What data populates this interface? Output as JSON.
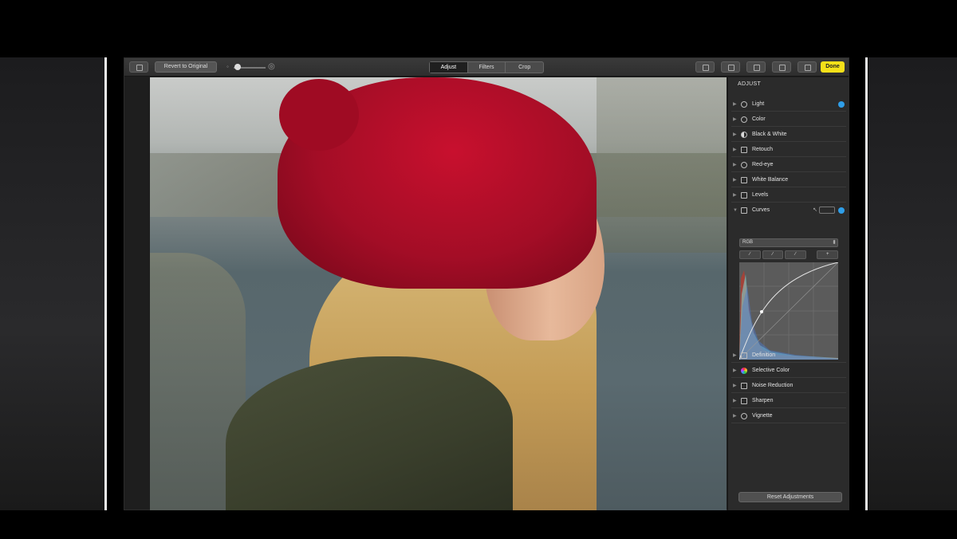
{
  "toolbar": {
    "revert_label": "Revert to Original",
    "tabs": [
      {
        "label": "Adjust",
        "active": true
      },
      {
        "label": "Filters",
        "active": false
      },
      {
        "label": "Crop",
        "active": false
      }
    ],
    "done_label": "Done",
    "zoom_level": 0.05
  },
  "panel": {
    "title": "ADJUST",
    "adjustments": [
      {
        "label": "Light",
        "icon": "sun-icon",
        "expanded": false,
        "modified": true
      },
      {
        "label": "Color",
        "icon": "circle-icon"
      },
      {
        "label": "Black & White",
        "icon": "half-circle-icon"
      },
      {
        "label": "Retouch",
        "icon": "bandage-icon"
      },
      {
        "label": "Red-eye",
        "icon": "eye-icon"
      },
      {
        "label": "White Balance",
        "icon": "white-balance-icon"
      },
      {
        "label": "Levels",
        "icon": "levels-icon"
      },
      {
        "label": "Curves",
        "icon": "curves-icon",
        "expanded": true,
        "modified": true
      }
    ],
    "curves": {
      "channel": "RGB",
      "tools": [
        "∕",
        "∕",
        "∕",
        "+"
      ]
    },
    "adjustments_more": [
      {
        "label": "Definition",
        "icon": "triangle-icon"
      },
      {
        "label": "Selective Color",
        "icon": "color-wheel-icon"
      },
      {
        "label": "Noise Reduction",
        "icon": "noise-icon"
      },
      {
        "label": "Sharpen",
        "icon": "sharpen-icon"
      },
      {
        "label": "Vignette",
        "icon": "vignette-icon"
      }
    ],
    "reset_label": "Reset Adjustments"
  },
  "colors": {
    "done": "#f5e019",
    "modified_dot": "#2f9ee8"
  }
}
